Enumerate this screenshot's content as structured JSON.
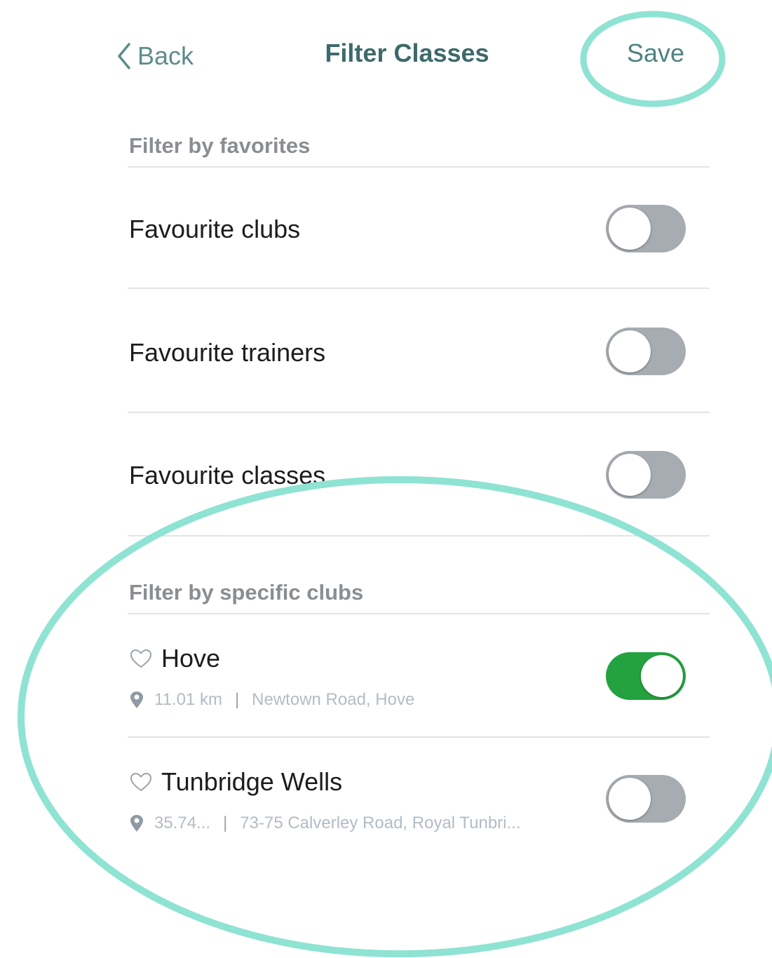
{
  "nav": {
    "back_label": "Back",
    "title": "Filter Classes",
    "save_label": "Save"
  },
  "favorites": {
    "header": "Filter by favorites",
    "rows": [
      {
        "label": "Favourite clubs",
        "enabled": false
      },
      {
        "label": "Favourite trainers",
        "enabled": false
      },
      {
        "label": "Favourite classes",
        "enabled": false
      }
    ]
  },
  "clubs": {
    "header": "Filter by specific clubs",
    "items": [
      {
        "name": "Hove",
        "distance": "11.01 km",
        "address": "Newtown Road, Hove",
        "enabled": true
      },
      {
        "name": "Tunbridge Wells",
        "distance": "35.74...",
        "address": "73-75 Calverley Road, Royal Tunbri...",
        "enabled": false
      }
    ]
  },
  "colors": {
    "accent": "#5f8c8b",
    "toggle_on": "#23a23f",
    "toggle_off": "#a7acb2",
    "annotation": "#8ee3d3"
  },
  "icons": {
    "back": "chevron-left-icon",
    "favorite": "heart-outline-icon",
    "location": "map-pin-icon"
  }
}
